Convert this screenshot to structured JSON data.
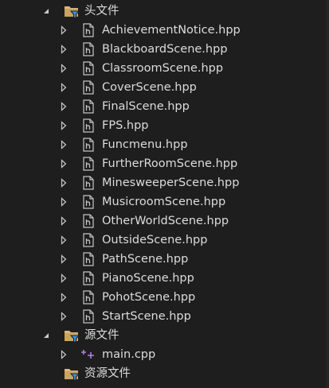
{
  "tree": {
    "folders": [
      {
        "label": "头文件",
        "expanded": true,
        "children": [
          "AchievementNotice.hpp",
          "BlackboardScene.hpp",
          "ClassroomScene.hpp",
          "CoverScene.hpp",
          "FinalScene.hpp",
          "FPS.hpp",
          "Funcmenu.hpp",
          "FurtherRoomScene.hpp",
          "MinesweeperScene.hpp",
          "MusicroomScene.hpp",
          "OtherWorldScene.hpp",
          "OutsideScene.hpp",
          "PathScene.hpp",
          "PianoScene.hpp",
          "PohotScene.hpp",
          "StartScene.hpp"
        ]
      },
      {
        "label": "源文件",
        "expanded": true,
        "children": [
          "main.cpp"
        ]
      },
      {
        "label": "资源文件",
        "expanded": false,
        "children": []
      }
    ]
  },
  "icons": {
    "header_file": "header-file-icon",
    "source_file": "cpp-source-file-icon",
    "filter_folder": "filter-folder-icon",
    "expanded_arrow": "expanded-arrow-icon",
    "collapsed_arrow": "collapsed-arrow-icon"
  },
  "colors": {
    "background": "#1e1e1e",
    "text": "#dcdcdc",
    "folder": "#dcb67a",
    "filter_badge": "#3c8dde",
    "arrow": "#c8c8c8",
    "file_icon": "#c5c5c5",
    "cpp_plus": "#b180d7"
  }
}
